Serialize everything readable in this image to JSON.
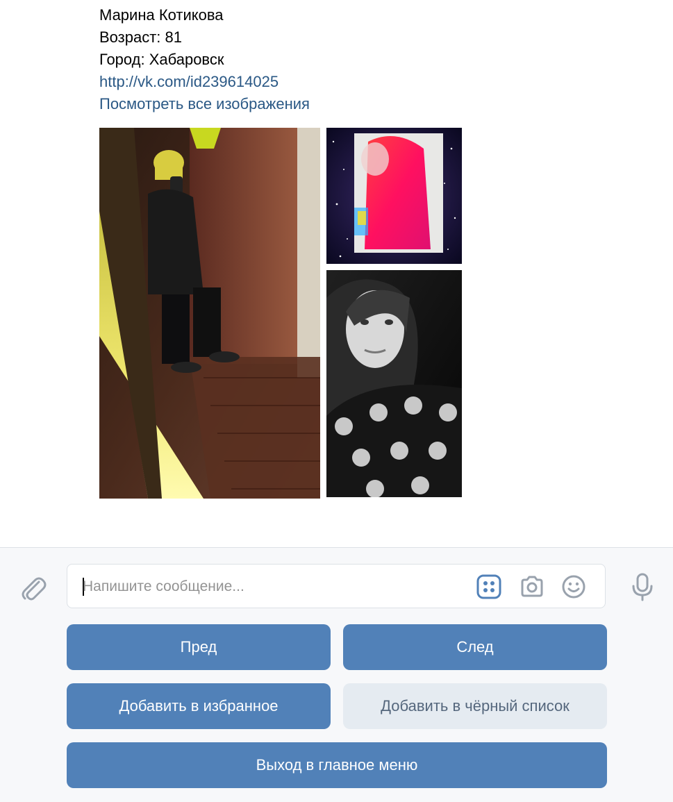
{
  "message": {
    "name": "Марина Котикова",
    "age": "Возраст: 81",
    "city": "Город: Хабаровск",
    "profile_link": "http://vk.com/id239614025",
    "view_all": "Посмотреть все изображения"
  },
  "photos": [
    "photo-yellow-hat-mirror-selfie",
    "photo-red-hair-galaxy",
    "photo-bw-bear-sweater"
  ],
  "composer": {
    "placeholder": "Напишите сообщение...",
    "icons": [
      "paperclip-icon",
      "keyboard-grid-icon",
      "camera-icon",
      "smile-icon",
      "microphone-icon"
    ]
  },
  "keyboard": {
    "prev": "Пред",
    "next": "След",
    "favorite": "Добавить в избранное",
    "blacklist": "Добавить в чёрный список",
    "exit": "Выход в главное меню"
  },
  "colors": {
    "link": "#2a5885",
    "primary_button": "#5181b8",
    "secondary_button": "#e5ebf1",
    "icon": "#99a2ad",
    "accent_icon": "#5181b8"
  }
}
